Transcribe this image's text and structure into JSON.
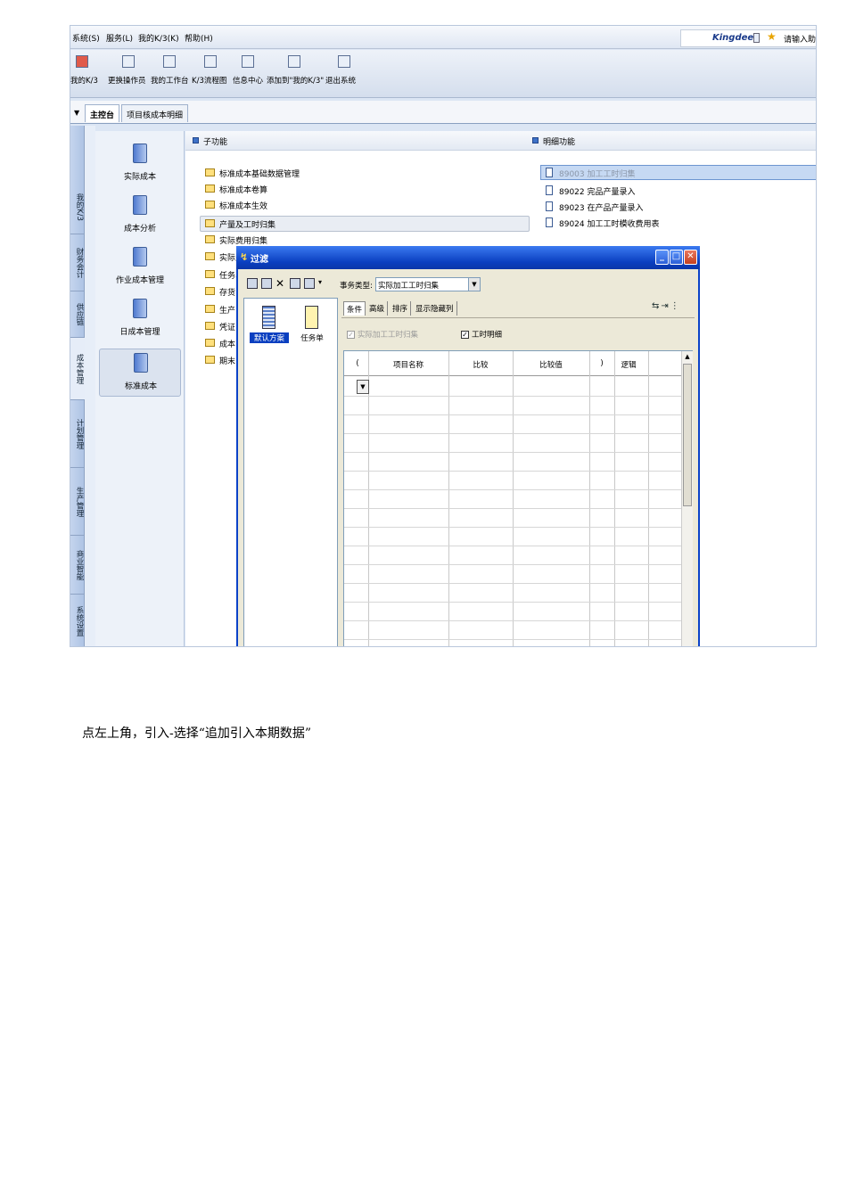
{
  "menubar": {
    "items": [
      "系统(S)",
      "服务(L)",
      "我的K/3(K)",
      "帮助(H)"
    ],
    "brand": "Kingdee",
    "search_hint": "请输入助记"
  },
  "toolbar": {
    "buttons": [
      {
        "label": "我的K/3",
        "icon": "k3-home-icon"
      },
      {
        "label": "更换操作员",
        "icon": "change-user-icon"
      },
      {
        "label": "我的工作台",
        "icon": "workbench-icon"
      },
      {
        "label": "K/3流程图",
        "icon": "flowchart-icon"
      },
      {
        "label": "信息中心",
        "icon": "message-center-icon"
      },
      {
        "label": "添加到\"我的K/3\"",
        "icon": "add-favorite-icon"
      },
      {
        "label": "退出系统",
        "icon": "exit-icon"
      }
    ]
  },
  "tabs": {
    "main": "主控台",
    "detail": "项目核成本明细"
  },
  "vnav": [
    "我的K/3",
    "财务会计",
    "供应链",
    "成本管理",
    "计划管理",
    "生产管理",
    "商业智能",
    "系统设置"
  ],
  "modules": [
    "实际成本",
    "成本分析",
    "作业成本管理",
    "日成本管理",
    "标准成本"
  ],
  "sub_functions": {
    "title": "子功能",
    "items": [
      "标准成本基础数据管理",
      "标准成本卷算",
      "标准成本生效",
      "产量及工时归集",
      "实际费用归集",
      "实际费",
      "任务单",
      "存货",
      "生产",
      "凭证",
      "成本",
      "期末"
    ]
  },
  "detail_functions": {
    "title": "明细功能",
    "items": [
      {
        "code": "89003",
        "name": "加工工时归集"
      },
      {
        "code": "89022",
        "name": "完品产量录入"
      },
      {
        "code": "89023",
        "name": "在产品产量录入"
      },
      {
        "code": "89024",
        "name": "加工工时模收费用表"
      }
    ]
  },
  "dialog": {
    "title": "过滤",
    "biz_type_label": "事务类型:",
    "biz_type_value": "实际加工工时归集",
    "left_items": [
      "默认方案",
      "任务单"
    ],
    "tabs": [
      "条件",
      "高级",
      "排序",
      "显示隐藏列"
    ],
    "checkbox_1": "实际加工工时归集",
    "checkbox_2": "工时明细",
    "grid_headers": [
      "(",
      "项目名称",
      "比较",
      "比较值",
      ")",
      "逻辑"
    ]
  },
  "caption": "点左上角，引入-选择“追加引入本期数据”"
}
